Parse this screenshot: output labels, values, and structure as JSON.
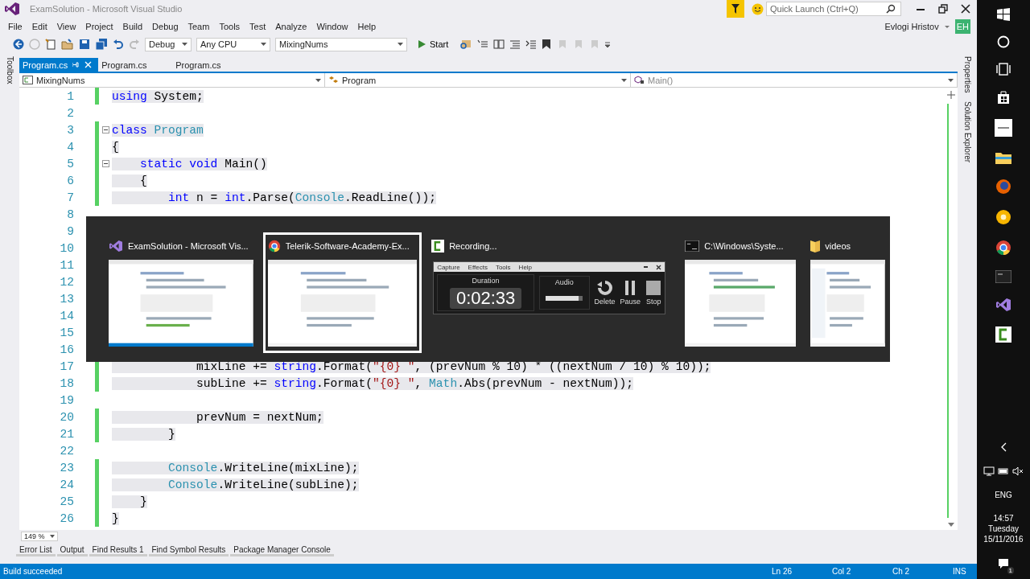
{
  "window": {
    "title": "ExamSolution - Microsoft Visual Studio"
  },
  "quick_launch": {
    "placeholder": "Quick Launch (Ctrl+Q)"
  },
  "menu": [
    "File",
    "Edit",
    "View",
    "Project",
    "Build",
    "Debug",
    "Team",
    "Tools",
    "Test",
    "Analyze",
    "Window",
    "Help"
  ],
  "user": {
    "name": "Evlogi Hristov",
    "initials": "EH"
  },
  "toolbar": {
    "configuration": "Debug",
    "platform": "Any CPU",
    "project": "MixingNums",
    "start": "Start"
  },
  "side_panels": {
    "left": [
      "Toolbox"
    ],
    "right": [
      "Properties",
      "Solution Explorer"
    ]
  },
  "tabs": [
    {
      "label": "Program.cs",
      "selected": true
    },
    {
      "label": "Program.cs",
      "selected": false
    },
    {
      "label": "Program.cs",
      "selected": false
    }
  ],
  "nav": [
    "MixingNums",
    "Program",
    "Main()"
  ],
  "code": [
    {
      "number": "1",
      "tokens": [
        {
          "text": "using",
          "kind": "keyword"
        },
        {
          "text": " System;",
          "kind": "plain"
        }
      ]
    },
    {
      "number": "2"
    },
    {
      "number": "3",
      "fold": true,
      "tokens": [
        {
          "text": "class",
          "kind": "keyword"
        },
        {
          "text": " Program",
          "kind": "type"
        }
      ]
    },
    {
      "number": "4",
      "tokens": [
        {
          "text": "{",
          "kind": "plain"
        }
      ]
    },
    {
      "number": "5",
      "fold": true,
      "tokens": [
        {
          "text": "    static",
          "kind": "keyword"
        },
        {
          "text": " void",
          "kind": "keyword"
        },
        {
          "text": " Main()",
          "kind": "plain"
        }
      ]
    },
    {
      "number": "6",
      "tokens": [
        {
          "text": "    {",
          "kind": "plain"
        }
      ]
    },
    {
      "number": "7",
      "tokens": [
        {
          "text": "        int",
          "kind": "keyword"
        },
        {
          "text": " n = ",
          "kind": "plain"
        },
        {
          "text": "int",
          "kind": "keyword"
        },
        {
          "text": ".Parse(",
          "kind": "plain"
        },
        {
          "text": "Console",
          "kind": "type"
        },
        {
          "text": ".ReadLine());",
          "kind": "plain"
        }
      ]
    },
    {
      "number": "8"
    },
    {
      "number": "9"
    },
    {
      "number": "10"
    },
    {
      "number": "11"
    },
    {
      "number": "12"
    },
    {
      "number": "13"
    },
    {
      "number": "14"
    },
    {
      "number": "15"
    },
    {
      "number": "16"
    },
    {
      "number": "17",
      "tokens": [
        {
          "text": "            mixLine += ",
          "kind": "plain"
        },
        {
          "text": "string",
          "kind": "keyword"
        },
        {
          "text": ".Format(",
          "kind": "plain"
        },
        {
          "text": "\"{0} \"",
          "kind": "string"
        },
        {
          "text": ", (prevNum % 10) * ((nextNum / 10) % 10));",
          "kind": "plain"
        }
      ]
    },
    {
      "number": "18",
      "tokens": [
        {
          "text": "            subLine += ",
          "kind": "plain"
        },
        {
          "text": "string",
          "kind": "keyword"
        },
        {
          "text": ".Format(",
          "kind": "plain"
        },
        {
          "text": "\"{0} \"",
          "kind": "string"
        },
        {
          "text": ", ",
          "kind": "plain"
        },
        {
          "text": "Math",
          "kind": "type"
        },
        {
          "text": ".Abs(prevNum - nextNum));",
          "kind": "plain"
        }
      ]
    },
    {
      "number": "19"
    },
    {
      "number": "20",
      "tokens": [
        {
          "text": "            prevNum = nextNum;",
          "kind": "plain"
        }
      ]
    },
    {
      "number": "21",
      "tokens": [
        {
          "text": "        }",
          "kind": "plain"
        }
      ]
    },
    {
      "number": "22"
    },
    {
      "number": "23",
      "tokens": [
        {
          "text": "        Console",
          "kind": "type"
        },
        {
          "text": ".WriteLine(mixLine);",
          "kind": "plain"
        }
      ]
    },
    {
      "number": "24",
      "tokens": [
        {
          "text": "        Console",
          "kind": "type"
        },
        {
          "text": ".WriteLine(subLine);",
          "kind": "plain"
        }
      ]
    },
    {
      "number": "25",
      "tokens": [
        {
          "text": "    }",
          "kind": "plain"
        }
      ]
    },
    {
      "number": "26",
      "tokens": [
        {
          "text": "}",
          "kind": "plain"
        }
      ]
    }
  ],
  "zoom": "149 %",
  "tool_tabs": [
    "Error List",
    "Output",
    "Find Results 1",
    "Find Symbol Results",
    "Package Manager Console"
  ],
  "status_bar": {
    "message": "Build succeeded",
    "ln": "Ln 26",
    "col": "Col 2",
    "ch": "Ch 2",
    "mode": "INS"
  },
  "task_switcher": [
    {
      "title": "ExamSolution - Microsoft Vis...",
      "kind": "vs",
      "selected": false
    },
    {
      "title": "Telerik-Software-Academy-Ex...",
      "kind": "browser",
      "selected": true
    },
    {
      "title": "Recording...",
      "kind": "recorder",
      "selected": false
    },
    {
      "title": "C:\\Windows\\Syste...",
      "kind": "console",
      "selected": false
    },
    {
      "title": "videos",
      "kind": "folder",
      "selected": false
    }
  ],
  "recorder": {
    "menu": [
      "Capture",
      "Effects",
      "Tools",
      "Help"
    ],
    "duration_label": "Duration",
    "time": "0:02:33",
    "audio_label": "Audio",
    "level": 0.88,
    "buttons": [
      "Delete",
      "Pause",
      "Stop"
    ]
  },
  "taskbar": {
    "language": "ENG",
    "time": "14:57",
    "day": "Tuesday",
    "date": "15/11/2016",
    "notifications": "1"
  }
}
